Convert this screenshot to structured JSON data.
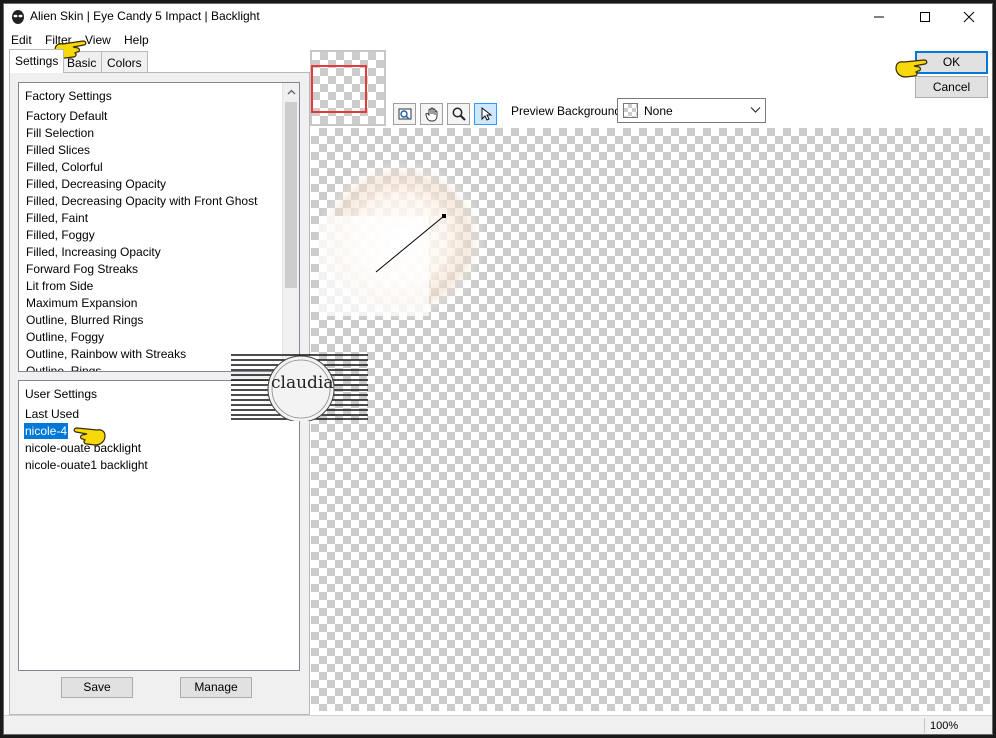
{
  "window": {
    "title": "Alien Skin | Eye Candy 5 Impact | Backlight"
  },
  "menu": [
    "Edit",
    "Filter",
    "View",
    "Help"
  ],
  "tabs": [
    "Settings",
    "Basic",
    "Colors"
  ],
  "factory_settings": {
    "header": "Factory Settings",
    "items": [
      "Factory Default",
      "Fill Selection",
      "Filled Slices",
      "Filled, Colorful",
      "Filled, Decreasing Opacity",
      "Filled, Decreasing Opacity with Front Ghost",
      "Filled, Faint",
      "Filled, Foggy",
      "Filled, Increasing Opacity",
      "Forward Fog Streaks",
      "Lit from Side",
      "Maximum Expansion",
      "Outline, Blurred Rings",
      "Outline, Foggy",
      "Outline, Rainbow with Streaks",
      "Outline, Rings"
    ]
  },
  "user_settings": {
    "header": "User Settings",
    "items": [
      "Last Used",
      "nicole-4",
      "nicole-ouate backlight",
      "nicole-ouate1 backlight"
    ],
    "selected": "nicole-4"
  },
  "buttons": {
    "save": "Save",
    "manage": "Manage",
    "ok": "OK",
    "cancel": "Cancel"
  },
  "preview": {
    "background_label": "Preview Background:",
    "background_value": "None"
  },
  "status": {
    "zoom": "100%"
  },
  "watermark_text": "claudia",
  "colors": {
    "selection": "#0078d7",
    "pointer_hand": "#f5d90a",
    "thumb_frame": "#e33b3b"
  }
}
